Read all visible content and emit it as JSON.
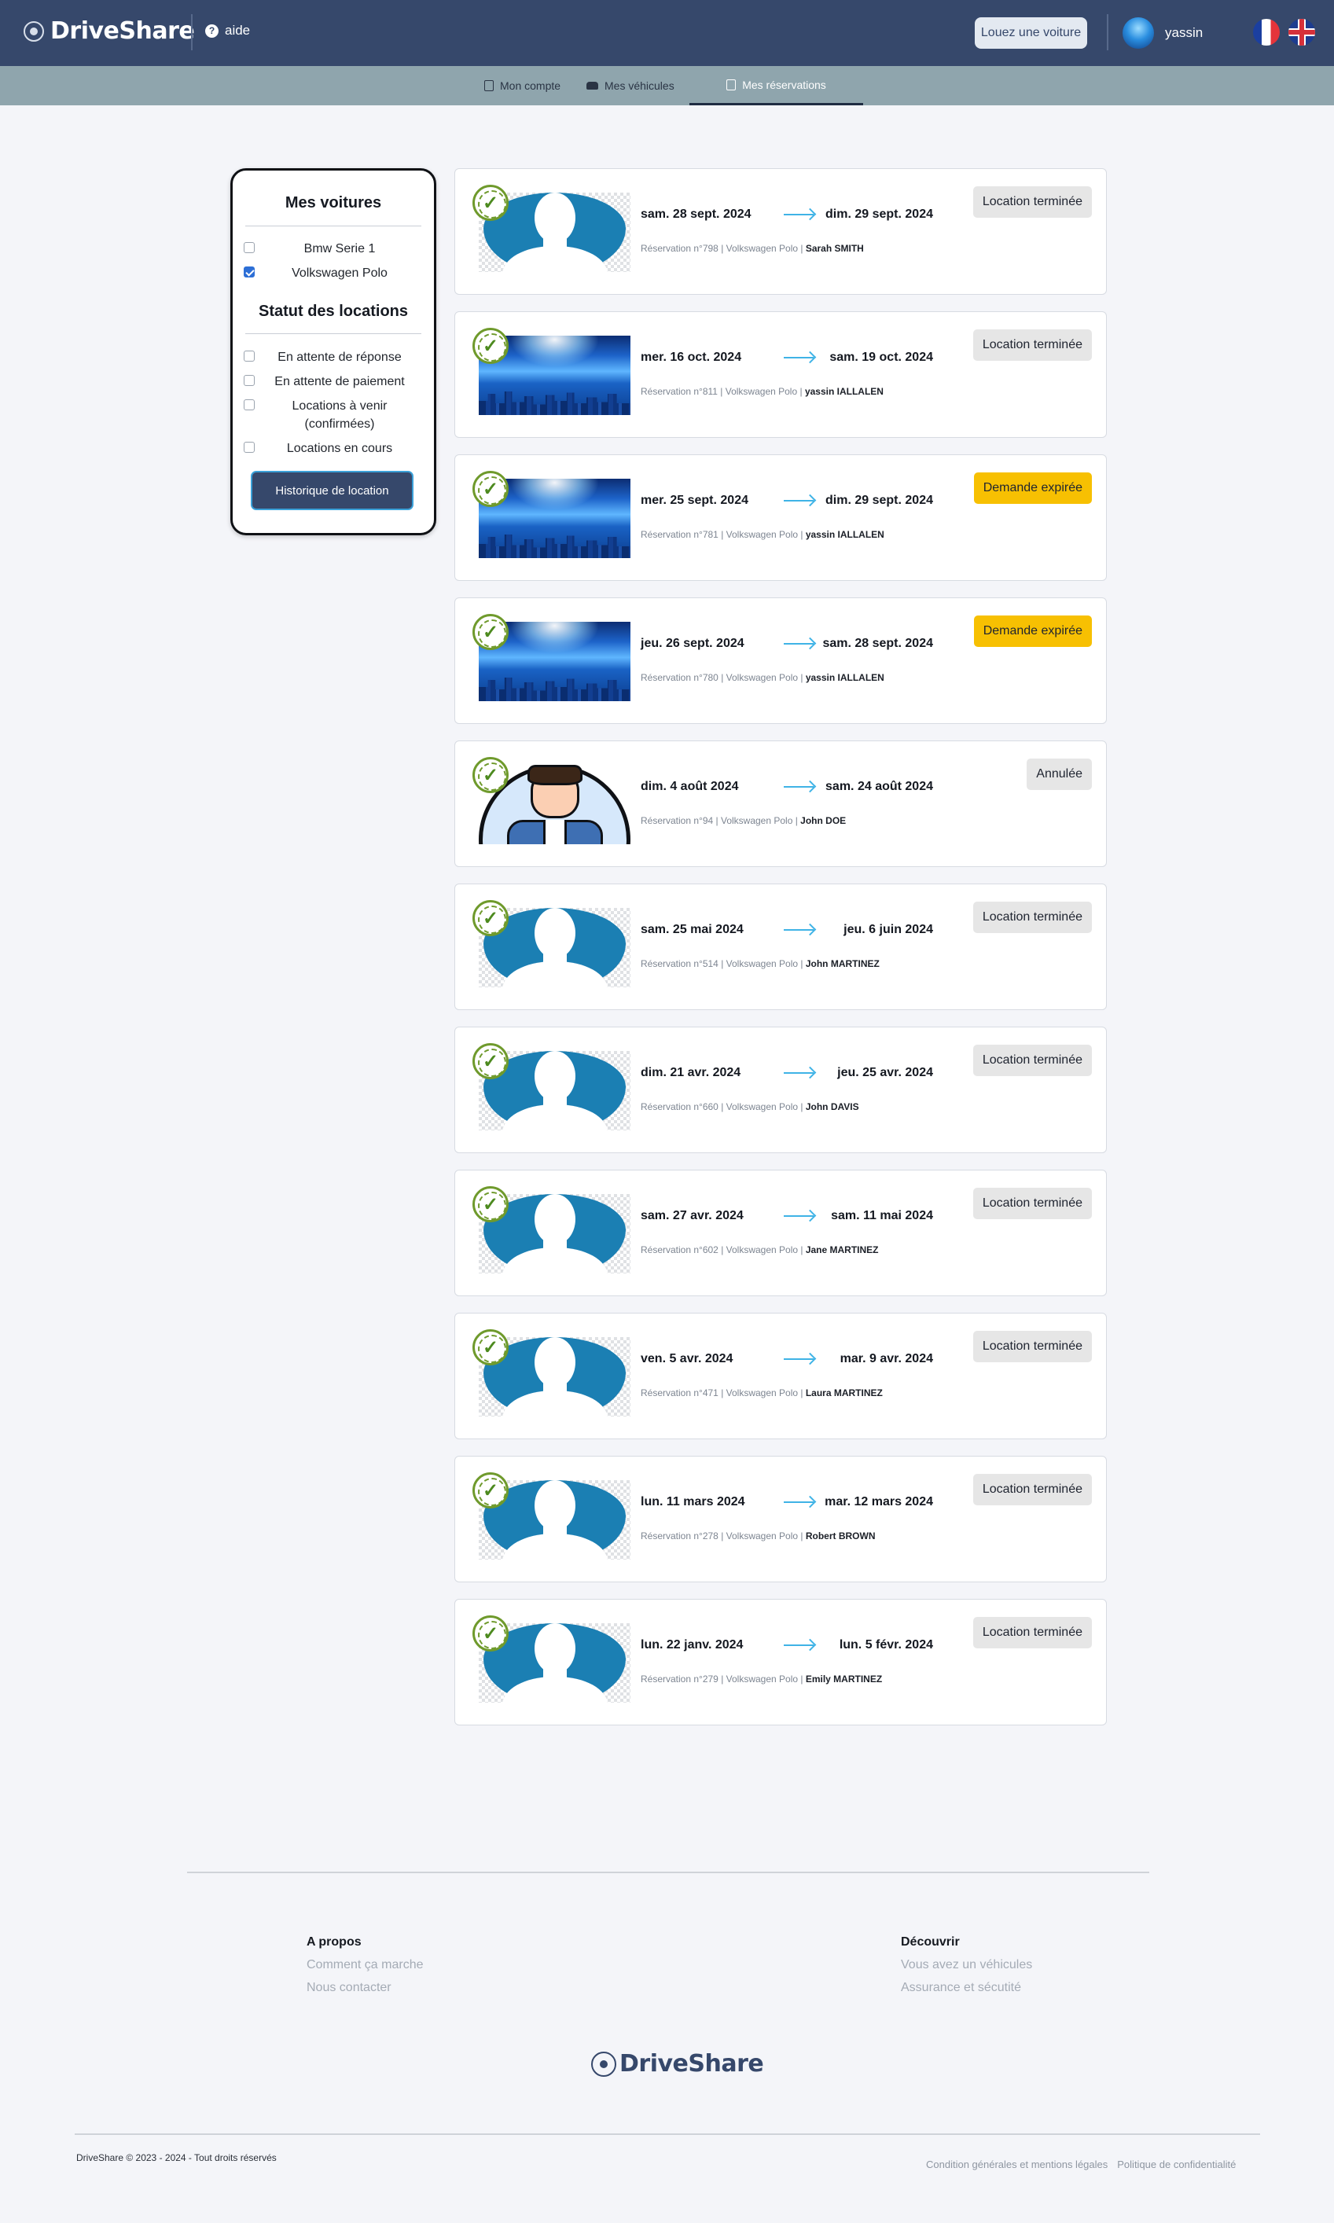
{
  "header": {
    "brand": "DriveShare",
    "help_label": "aide",
    "rent_button": "Louez une voiture",
    "username": "yassin",
    "colors": {
      "topbar": "#36486b",
      "subnav": "#8fa5ad"
    }
  },
  "subnav": {
    "tabs": [
      {
        "label": "Mon compte",
        "icon": "document-icon",
        "active": false
      },
      {
        "label": "Mes véhicules",
        "icon": "car-icon",
        "active": false
      },
      {
        "label": "Mes réservations",
        "icon": "calendar-icon",
        "active": true
      }
    ]
  },
  "filters": {
    "cars_title": "Mes voitures",
    "cars": [
      {
        "label": "Bmw Serie 1",
        "checked": false
      },
      {
        "label": "Volkswagen Polo",
        "checked": true
      }
    ],
    "status_title": "Statut des locations",
    "statuses": [
      {
        "label": "En attente de réponse",
        "checked": false
      },
      {
        "label": "En attente de paiement",
        "checked": false
      },
      {
        "label": "Locations à venir (confirmées)",
        "checked": false
      },
      {
        "label": "Locations en cours",
        "checked": false
      }
    ],
    "history_button": "Historique de location"
  },
  "reservations": [
    {
      "from": "sam. 28 sept. 2024",
      "to": "dim. 29 sept. 2024",
      "ref": "Réservation n°798 | Volkswagen Polo | ",
      "renter": "Sarah SMITH",
      "status": "Location terminée",
      "status_color": "#e6e6e6",
      "thumb": "person"
    },
    {
      "from": "mer. 16 oct. 2024",
      "to": "sam. 19 oct. 2024",
      "ref": "Réservation n°811 | Volkswagen Polo | ",
      "renter": "yassin IALLALEN",
      "status": "Location terminée",
      "status_color": "#e6e6e6",
      "thumb": "city"
    },
    {
      "from": "mer. 25 sept. 2024",
      "to": "dim. 29 sept. 2024",
      "ref": "Réservation n°781 | Volkswagen Polo | ",
      "renter": "yassin IALLALEN",
      "status": "Demande expirée",
      "status_color": "#f7c002",
      "thumb": "city"
    },
    {
      "from": "jeu. 26 sept. 2024",
      "to": "sam. 28 sept. 2024",
      "ref": "Réservation n°780 | Volkswagen Polo | ",
      "renter": "yassin IALLALEN",
      "status": "Demande expirée",
      "status_color": "#f7c002",
      "thumb": "city"
    },
    {
      "from": "dim. 4 août 2024",
      "to": "sam. 24 août 2024",
      "ref": "Réservation n°94 | Volkswagen Polo | ",
      "renter": "John DOE",
      "status": "Annulée",
      "status_color": "#e6e6e6",
      "thumb": "man"
    },
    {
      "from": "sam. 25 mai 2024",
      "to": "jeu. 6 juin 2024",
      "ref": "Réservation n°514 | Volkswagen Polo | ",
      "renter": "John MARTINEZ",
      "status": "Location terminée",
      "status_color": "#e6e6e6",
      "thumb": "person"
    },
    {
      "from": "dim. 21 avr. 2024",
      "to": "jeu. 25 avr. 2024",
      "ref": "Réservation n°660 | Volkswagen Polo | ",
      "renter": "John DAVIS",
      "status": "Location terminée",
      "status_color": "#e6e6e6",
      "thumb": "person"
    },
    {
      "from": "sam. 27 avr. 2024",
      "to": "sam. 11 mai 2024",
      "ref": "Réservation n°602 | Volkswagen Polo | ",
      "renter": "Jane MARTINEZ",
      "status": "Location terminée",
      "status_color": "#e6e6e6",
      "thumb": "person"
    },
    {
      "from": "ven. 5 avr. 2024",
      "to": "mar. 9 avr. 2024",
      "ref": "Réservation n°471 | Volkswagen Polo | ",
      "renter": "Laura MARTINEZ",
      "status": "Location terminée",
      "status_color": "#e6e6e6",
      "thumb": "person"
    },
    {
      "from": "lun. 11 mars 2024",
      "to": "mar. 12 mars 2024",
      "ref": "Réservation n°278 | Volkswagen Polo | ",
      "renter": "Robert BROWN",
      "status": "Location terminée",
      "status_color": "#e6e6e6",
      "thumb": "person"
    },
    {
      "from": "lun. 22 janv. 2024",
      "to": "lun. 5 févr. 2024",
      "ref": "Réservation n°279 | Volkswagen Polo | ",
      "renter": "Emily MARTINEZ",
      "status": "Location terminée",
      "status_color": "#e6e6e6",
      "thumb": "person"
    }
  ],
  "footer": {
    "about_title": "A propos",
    "about_links": [
      "Comment ça marche",
      "Nous contacter"
    ],
    "discover_title": "Découvrir",
    "discover_links": [
      "Vous avez un véhicules",
      "Assurance et sécutité"
    ],
    "brand": "DriveShare",
    "copyright": "DriveShare © 2023 - 2024 - Tout droits réservés",
    "legal_links": [
      "Condition générales et mentions légales",
      "Politique de confidentialité"
    ]
  }
}
